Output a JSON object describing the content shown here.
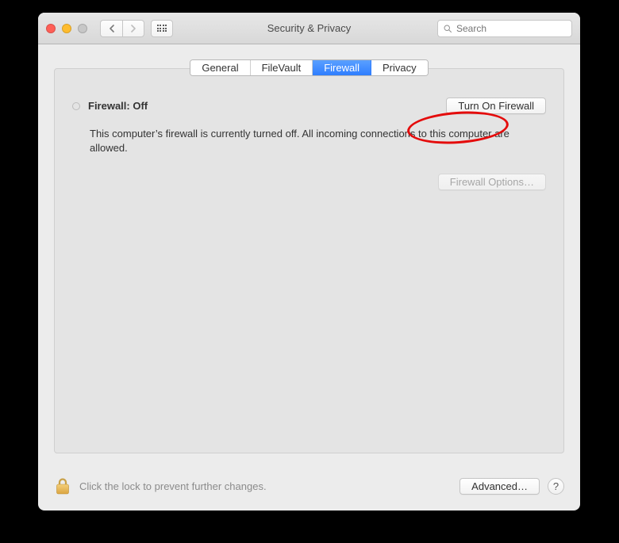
{
  "window": {
    "title": "Security & Privacy"
  },
  "search": {
    "placeholder": "Search"
  },
  "tabs": [
    {
      "label": "General"
    },
    {
      "label": "FileVault"
    },
    {
      "label": "Firewall",
      "active": true
    },
    {
      "label": "Privacy"
    }
  ],
  "firewall": {
    "status_label": "Firewall: Off",
    "turn_on_label": "Turn On Firewall",
    "description": "This computer’s firewall is currently turned off. All incoming connections to this computer are allowed.",
    "options_label": "Firewall Options…"
  },
  "footer": {
    "lock_text": "Click the lock to prevent further changes.",
    "advanced_label": "Advanced…",
    "help_label": "?"
  }
}
